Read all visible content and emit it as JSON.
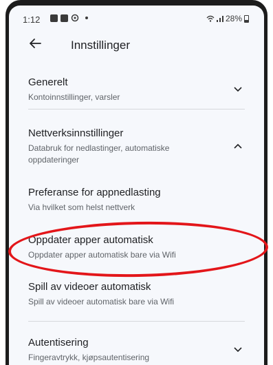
{
  "statusbar": {
    "time": "1:12",
    "signal": "28%"
  },
  "appbar": {
    "title": "Innstillinger"
  },
  "items": [
    {
      "title": "Generelt",
      "subtitle": "Kontoinnstillinger, varsler"
    },
    {
      "title": "Nettverksinnstillinger",
      "subtitle": "Databruk for nedlastinger, automatiske oppdateringer"
    },
    {
      "title": "Preferanse for appnedlasting",
      "subtitle": "Via hvilket som helst nettverk"
    },
    {
      "title": "Oppdater apper automatisk",
      "subtitle": "Oppdater apper automatisk bare via Wifi"
    },
    {
      "title": "Spill av videoer automatisk",
      "subtitle": "Spill av videoer automatisk bare via Wifi"
    },
    {
      "title": "Autentisering",
      "subtitle": "Fingeravtrykk, kjøpsautentisering"
    }
  ],
  "colors": {
    "highlight": "#e3161a",
    "background": "#f6f8fc"
  }
}
